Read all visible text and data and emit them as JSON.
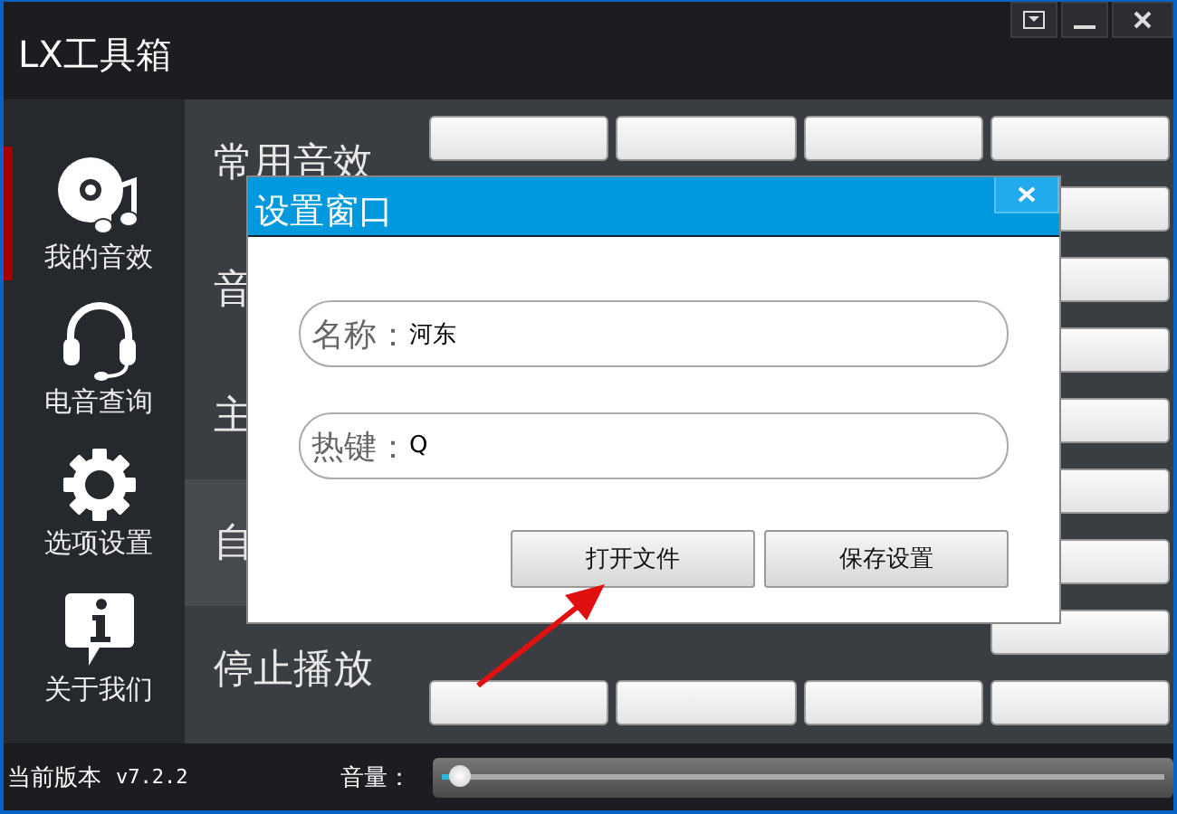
{
  "window": {
    "title": "LX工具箱"
  },
  "sidebar": {
    "items": [
      {
        "label": "我的音效",
        "kind": "disc",
        "selected": true
      },
      {
        "label": "电音查询",
        "kind": "headset",
        "selected": false
      },
      {
        "label": "选项设置",
        "kind": "gear",
        "selected": false
      },
      {
        "label": "关于我们",
        "kind": "info",
        "selected": false
      }
    ]
  },
  "categories": [
    {
      "label": "常用音效",
      "selected": false
    },
    {
      "label": "音",
      "selected": false
    },
    {
      "label": "主",
      "selected": false
    },
    {
      "label": "自",
      "selected": true
    },
    {
      "label": "停止播放",
      "selected": false
    }
  ],
  "dialog": {
    "title": "设置窗口",
    "fields": [
      {
        "label": "名称：",
        "value": "河东"
      },
      {
        "label": "热键：",
        "value": "Q"
      }
    ],
    "buttons": [
      {
        "label": "打开文件"
      },
      {
        "label": "保存设置"
      }
    ]
  },
  "status_bar": {
    "version_label": "当前版本",
    "version": "v7.2.2",
    "volume_label": "音量：",
    "volume": {
      "level": 0.02
    }
  }
}
